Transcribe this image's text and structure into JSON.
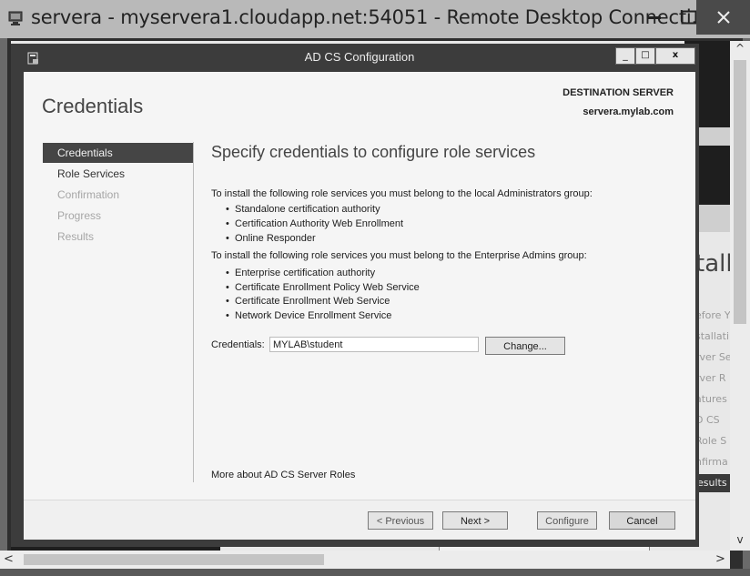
{
  "rdp": {
    "title": "servera - myservera1.cloudapp.net:54051 - Remote Desktop Connecti...",
    "minimize": "—",
    "maximize": "☐",
    "close": "✕",
    "app_icon": "remote-desktop-icon",
    "scroll_up": "^",
    "scroll_down": "v",
    "scroll_left": "<",
    "scroll_right": ">"
  },
  "background_window": {
    "heading_fragment": "talla",
    "nav_fragments": [
      "efore Y",
      "stallati",
      "rver Se",
      "rver R",
      "atures",
      "D CS",
      "Role S",
      "nfirma"
    ],
    "results_fragment": "esults"
  },
  "dialog": {
    "title": "AD CS Configuration",
    "icon": "adcs-config-icon",
    "min": "_",
    "max": "□",
    "close": "x",
    "page_title": "Credentials",
    "destination_label": "DESTINATION SERVER",
    "destination_value": "servera.mylab.com",
    "nav": [
      {
        "label": "Credentials",
        "state": "active"
      },
      {
        "label": "Role Services",
        "state": "normal"
      },
      {
        "label": "Confirmation",
        "state": "disabled"
      },
      {
        "label": "Progress",
        "state": "disabled"
      },
      {
        "label": "Results",
        "state": "disabled"
      }
    ],
    "heading": "Specify credentials to configure role services",
    "local_admin_text": "To install the following role services you must belong to the local Administrators group:",
    "local_admin_services": [
      "Standalone certification authority",
      "Certification Authority Web Enrollment",
      "Online Responder"
    ],
    "enterprise_admin_text": "To install the following role services you must belong to the Enterprise Admins group:",
    "enterprise_admin_services": [
      "Enterprise certification authority",
      "Certificate Enrollment Policy Web Service",
      "Certificate Enrollment Web Service",
      "Network Device Enrollment Service"
    ],
    "credentials_label": "Credentials:",
    "credentials_value": "MYLAB\\student",
    "change_button": "Change...",
    "more_link": "More about AD CS Server Roles",
    "buttons": {
      "previous": "< Previous",
      "next": "Next >",
      "configure": "Configure",
      "cancel": "Cancel"
    }
  }
}
